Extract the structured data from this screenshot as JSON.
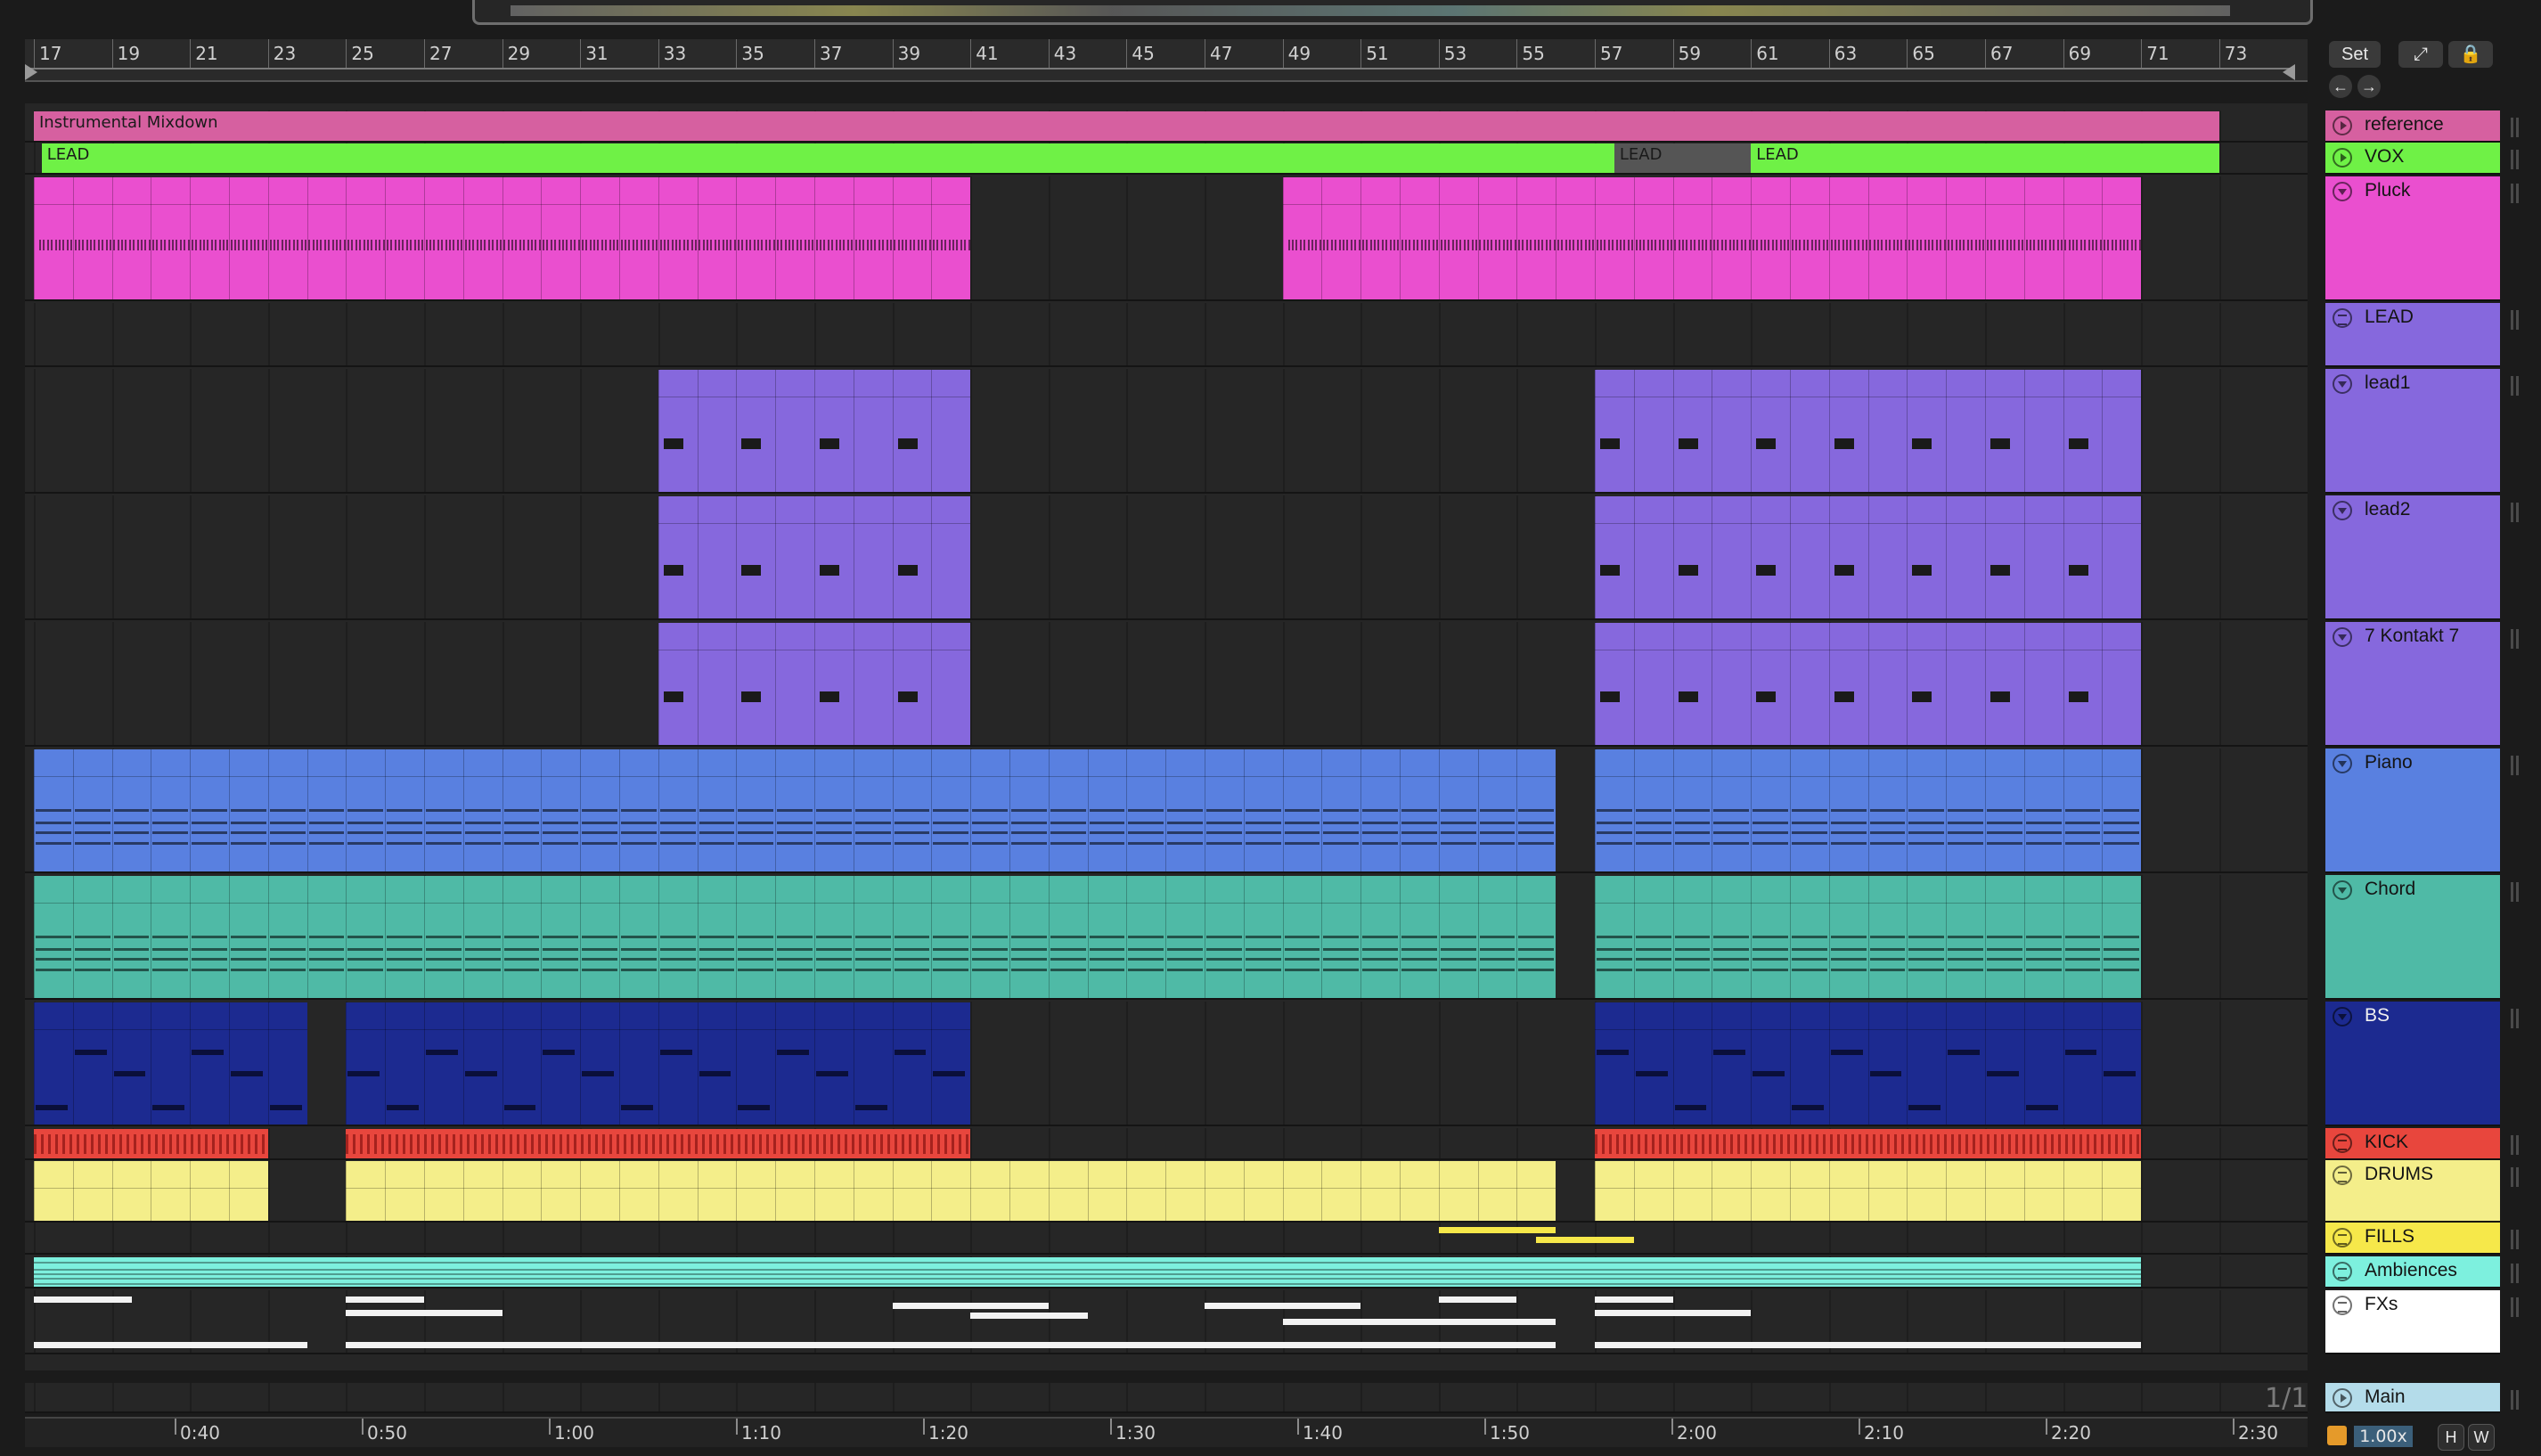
{
  "ruler": {
    "bars": [
      "17",
      "19",
      "21",
      "23",
      "25",
      "27",
      "29",
      "31",
      "33",
      "35",
      "37",
      "39",
      "41",
      "43",
      "45",
      "47",
      "49",
      "51",
      "53",
      "55",
      "57",
      "59",
      "61",
      "63",
      "65",
      "67",
      "69",
      "71",
      "73"
    ]
  },
  "time_ruler": {
    "labels": [
      "0:40",
      "0:50",
      "1:00",
      "1:10",
      "1:20",
      "1:30",
      "1:40",
      "1:50",
      "2:00",
      "2:10",
      "2:20",
      "2:30"
    ]
  },
  "controls": {
    "set_label": "Set",
    "expand_icon": "expand-icon",
    "lock_icon": "lock-icon",
    "back_icon": "arrow-left-icon",
    "forward_icon": "arrow-right-icon",
    "page_counter": "1/1",
    "zoom_value": "1.00x",
    "h_label": "H",
    "w_label": "W"
  },
  "tracks": [
    {
      "name": "reference",
      "color": "#d660a0",
      "icon": "play-icon"
    },
    {
      "name": "VOX",
      "color": "#6ff146",
      "icon": "play-icon"
    },
    {
      "name": "Pluck",
      "color": "#ea4fcf",
      "icon": "fold-icon"
    },
    {
      "name": "LEAD",
      "color": "#8668dd",
      "icon": "group-icon"
    },
    {
      "name": "lead1",
      "color": "#8668dd",
      "icon": "fold-icon"
    },
    {
      "name": "lead2",
      "color": "#8668dd",
      "icon": "fold-icon"
    },
    {
      "name": "7 Kontakt 7",
      "color": "#8668dd",
      "icon": "fold-icon"
    },
    {
      "name": "Piano",
      "color": "#5980e0",
      "icon": "fold-icon"
    },
    {
      "name": "Chord",
      "color": "#4fbaa6",
      "icon": "fold-icon"
    },
    {
      "name": "BS",
      "color": "#1c2a90",
      "icon": "fold-icon"
    },
    {
      "name": "KICK",
      "color": "#e8463d",
      "icon": "group-icon"
    },
    {
      "name": "DRUMS",
      "color": "#f4ee8a",
      "icon": "group-icon"
    },
    {
      "name": "FILLS",
      "color": "#f6e84a",
      "icon": "group-icon"
    },
    {
      "name": "Ambiences",
      "color": "#7df0de",
      "icon": "group-icon"
    },
    {
      "name": "FXs",
      "color": "#ffffff",
      "icon": "group-icon"
    },
    {
      "name": "Main",
      "color": "#b4dcea",
      "icon": "play-icon"
    }
  ],
  "clips": {
    "reference": "Instrumental Mixdown",
    "vox_1": "LEAD",
    "vox_2": "LEAD",
    "vox_3": "LEAD"
  }
}
